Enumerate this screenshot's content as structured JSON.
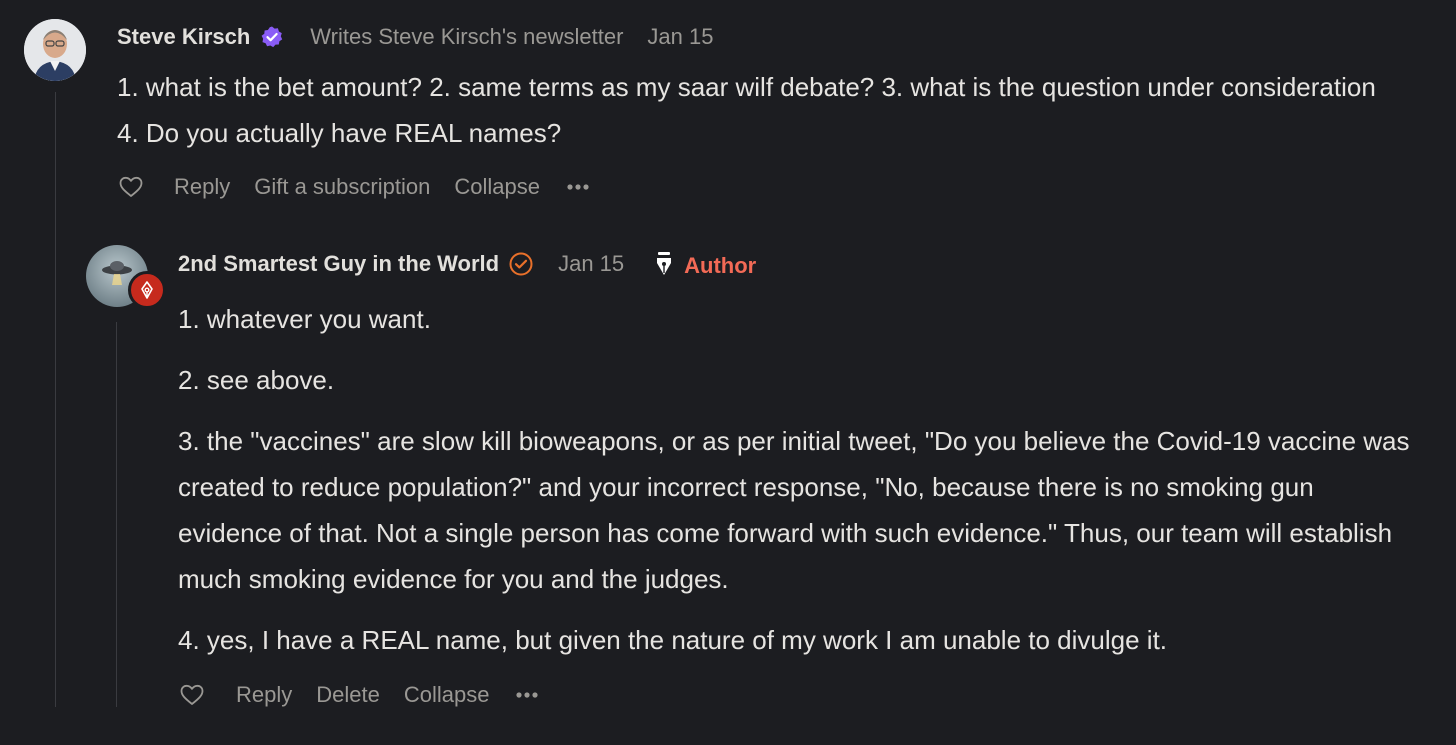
{
  "colors": {
    "background": "#1c1d21",
    "text": "#e6e4e1",
    "muted": "#9a9894",
    "verified_purple": "#8a5cf6",
    "author_orange": "#f26a56",
    "pen_badge_red": "#c62a1d"
  },
  "comments": [
    {
      "author": "Steve Kirsch",
      "badge_icon": "verified-check-icon",
      "byline": "Writes Steve Kirsch's newsletter",
      "date": "Jan 15",
      "body": [
        "1. what is the bet amount? 2. same terms as my saar wilf debate? 3. what is the question under consideration 4. Do you actually have REAL names?"
      ],
      "actions": {
        "reply": "Reply",
        "gift": "Gift a subscription",
        "collapse": "Collapse"
      }
    },
    {
      "author": "2nd Smartest Guy in the World",
      "badge_icon": "check-circle-icon",
      "date": "Jan 15",
      "author_label": "Author",
      "body": [
        "1. whatever you want.",
        "2. see above.",
        "3. the \"vaccines\" are slow kill bioweapons, or as per initial tweet, \"Do you believe the Covid-19 vaccine was created to reduce population?\" and your incorrect response, \"No, because there is no smoking gun evidence of that. Not a single person has come forward with such evidence.\" Thus, our team will establish much smoking evidence for you and the judges.",
        "4. yes, I have a REAL name, but given the nature of my work I am unable to divulge it."
      ],
      "actions": {
        "reply": "Reply",
        "delete": "Delete",
        "collapse": "Collapse"
      }
    }
  ]
}
